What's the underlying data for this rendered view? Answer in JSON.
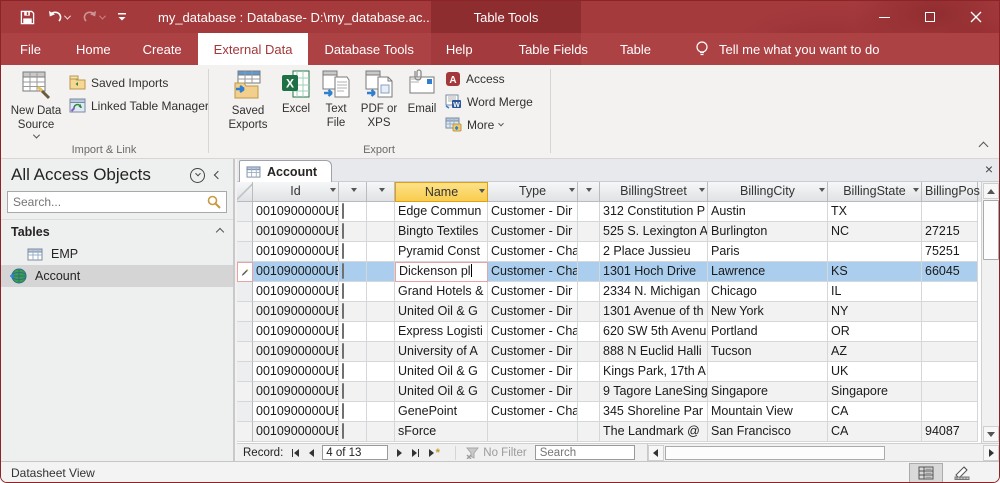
{
  "titlebar": {
    "title": "my_database : Database- D:\\my_database.ac...",
    "context_title": "Table Tools"
  },
  "ribbon_tabs": {
    "file": "File",
    "home": "Home",
    "create": "Create",
    "external_data": "External Data",
    "database_tools": "Database Tools",
    "help": "Help",
    "table_fields": "Table Fields",
    "table": "Table",
    "tellme": "Tell me what you want to do"
  },
  "ribbon": {
    "import_link": {
      "label": "Import & Link",
      "new_data_source": "New Data Source",
      "saved_imports": "Saved Imports",
      "linked_table_manager": "Linked Table Manager"
    },
    "export": {
      "label": "Export",
      "saved_exports": "Saved Exports",
      "excel": "Excel",
      "text_file": "Text File",
      "pdf_xps": "PDF or XPS",
      "email": "Email",
      "access": "Access",
      "word_merge": "Word Merge",
      "more": "More"
    }
  },
  "nav_pane": {
    "title": "All Access Objects",
    "search_placeholder": "Search...",
    "group_label": "Tables",
    "items": [
      {
        "label": "EMP",
        "icon": "table-icon",
        "selected": false
      },
      {
        "label": "Account",
        "icon": "linked-table-icon",
        "selected": true
      }
    ]
  },
  "document": {
    "tab_label": "Account",
    "headers": {
      "id": "Id",
      "name": "Name",
      "type": "Type",
      "street": "BillingStreet",
      "city": "BillingCity",
      "state": "BillingState",
      "postal": "BillingPos"
    },
    "rows": [
      {
        "id": "0010900000UB:",
        "name": "Edge Commun",
        "type": "Customer - Dir",
        "street": "312 Constitution P",
        "city": "Austin",
        "state": "TX",
        "postal": "",
        "selected": false,
        "editing": false
      },
      {
        "id": "0010900000UB:",
        "name": "Bingto Textiles",
        "type": "Customer - Dir",
        "street": "525 S. Lexington A",
        "city": "Burlington",
        "state": "NC",
        "postal": "27215",
        "selected": false,
        "editing": false
      },
      {
        "id": "0010900000UB:",
        "name": "Pyramid Const",
        "type": "Customer - Cha",
        "street": "2 Place Jussieu",
        "city": "Paris",
        "state": "",
        "postal": "75251",
        "selected": false,
        "editing": false
      },
      {
        "id": "0010900000UB:",
        "name": "Dickenson pl",
        "type": "Customer - Cha",
        "street": "1301 Hoch Drive",
        "city": "Lawrence",
        "state": "KS",
        "postal": "66045",
        "selected": true,
        "editing": true
      },
      {
        "id": "0010900000UB:",
        "name": "Grand Hotels &",
        "type": "Customer - Dir",
        "street": "2334 N. Michigan",
        "city": "Chicago",
        "state": "IL",
        "postal": "",
        "selected": false,
        "editing": false
      },
      {
        "id": "0010900000UB:",
        "name": "United Oil & G",
        "type": "Customer - Dir",
        "street": "1301 Avenue of th",
        "city": "New York",
        "state": "NY",
        "postal": "",
        "selected": false,
        "editing": false
      },
      {
        "id": "0010900000UB:",
        "name": "Express Logisti",
        "type": "Customer - Cha",
        "street": "620 SW 5th Avenu",
        "city": "Portland",
        "state": "OR",
        "postal": "",
        "selected": false,
        "editing": false
      },
      {
        "id": "0010900000UB:",
        "name": "University of A",
        "type": "Customer - Dir",
        "street": "888 N Euclid Halli",
        "city": "Tucson",
        "state": "AZ",
        "postal": "",
        "selected": false,
        "editing": false
      },
      {
        "id": "0010900000UB:",
        "name": "United Oil & G",
        "type": "Customer - Dir",
        "street": "Kings Park, 17th A",
        "city": "",
        "state": "UK",
        "postal": "",
        "selected": false,
        "editing": false
      },
      {
        "id": "0010900000UB:",
        "name": "United Oil & G",
        "type": "Customer - Dir",
        "street": "9 Tagore LaneSing",
        "city": "Singapore",
        "state": "Singapore",
        "postal": "",
        "selected": false,
        "editing": false
      },
      {
        "id": "0010900000UB:",
        "name": "GenePoint",
        "type": "Customer - Cha",
        "street": "345 Shoreline Par",
        "city": "Mountain View",
        "state": "CA",
        "postal": "",
        "selected": false,
        "editing": false
      },
      {
        "id": "0010900000UB:",
        "name": "sForce",
        "type": "",
        "street": "The Landmark @ ",
        "city": "San Francisco",
        "state": "CA",
        "postal": "94087",
        "selected": false,
        "editing": false
      }
    ]
  },
  "record_nav": {
    "label": "Record:",
    "position": "4 of 13",
    "no_filter_label": "No Filter",
    "search_placeholder": "Search"
  },
  "status_bar": {
    "view_name": "Datasheet View"
  },
  "colors": {
    "titlebar_red": "#a53a3d",
    "context_red": "#8e2d30",
    "active_tab_text": "#a4373a",
    "selected_row": "#abceee",
    "name_header_yellow": "#f8cd4e",
    "edit_cell_border": "#e8a3a6"
  }
}
